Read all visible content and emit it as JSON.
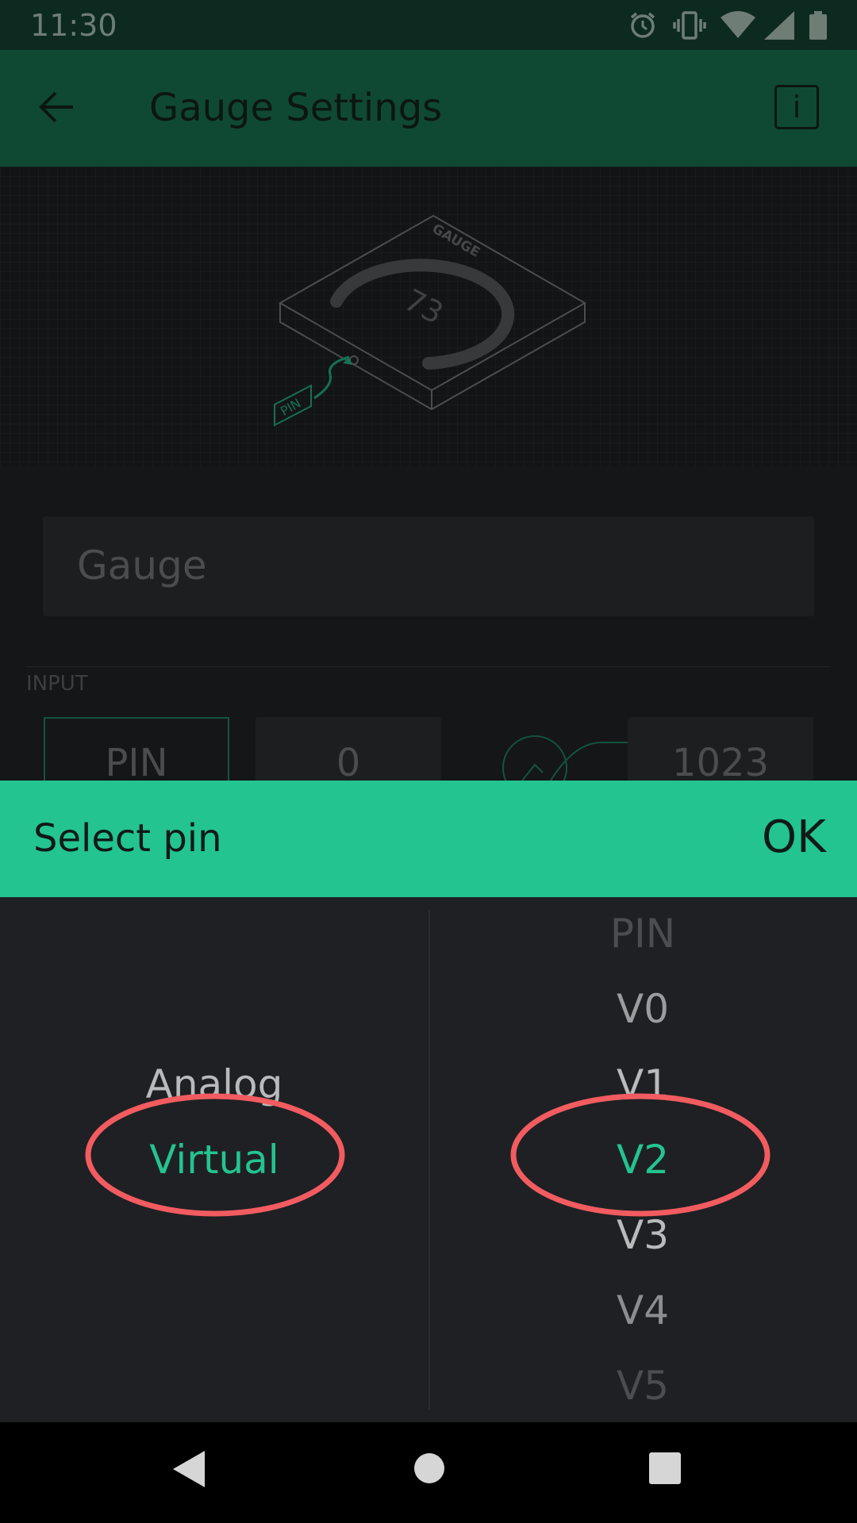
{
  "status_bar": {
    "time": "11:30",
    "icons": [
      "alarm-icon",
      "vibrate-icon",
      "wifi-icon",
      "signal-icon",
      "battery-icon"
    ]
  },
  "app_bar": {
    "title": "Gauge Settings",
    "back_icon": "arrow-left-icon",
    "info_label": "i"
  },
  "preview": {
    "widget_label": "GAUGE",
    "gauge_value": "73",
    "pin_tag": "PIN"
  },
  "settings": {
    "name_value": "Gauge",
    "input_section_label": "INPUT",
    "pin_button_label": "PIN",
    "min_value": "0",
    "max_value": "1023"
  },
  "dialog": {
    "title": "Select pin",
    "ok_label": "OK",
    "pin_types": [
      "Analog",
      "Virtual"
    ],
    "selected_pin_type": "Virtual",
    "pins": [
      "PIN",
      "V0",
      "V1",
      "V2",
      "V3",
      "V4",
      "V5"
    ],
    "selected_pin": "V2"
  },
  "colors": {
    "accent": "#23c48f",
    "app_bar": "#0f4934",
    "annotation_circle": "#f25c60"
  },
  "nav_bar": {
    "icons": [
      "back-triangle-icon",
      "home-circle-icon",
      "recents-square-icon"
    ]
  }
}
